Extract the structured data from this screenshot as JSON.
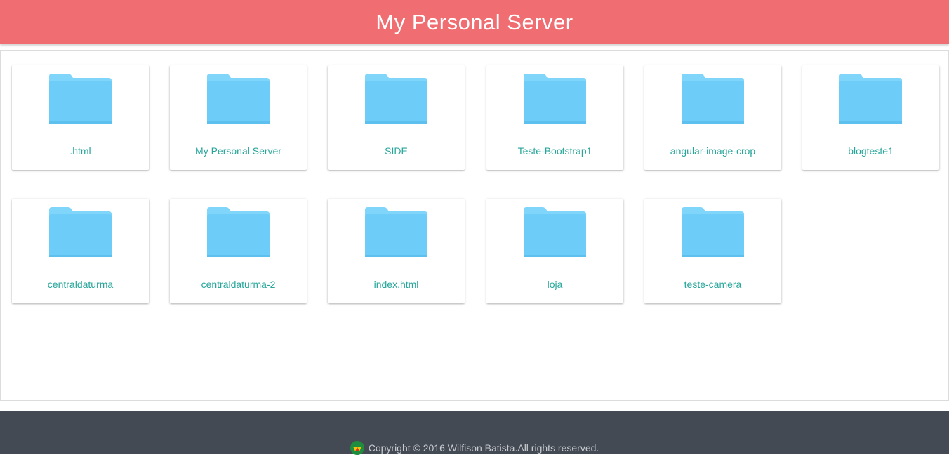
{
  "header": {
    "title": "My Personal Server"
  },
  "folders": [
    {
      "name": ".html",
      "icon": "folder-icon"
    },
    {
      "name": "My Personal Server",
      "icon": "folder-icon"
    },
    {
      "name": "SIDE",
      "icon": "folder-icon"
    },
    {
      "name": "Teste-Bootstrap1",
      "icon": "folder-icon"
    },
    {
      "name": "angular-image-crop",
      "icon": "folder-icon"
    },
    {
      "name": "blogteste1",
      "icon": "folder-icon"
    },
    {
      "name": "centraldaturma",
      "icon": "folder-icon"
    },
    {
      "name": "centraldaturma-2",
      "icon": "folder-icon"
    },
    {
      "name": "index.html",
      "icon": "folder-icon"
    },
    {
      "name": "loja",
      "icon": "folder-icon"
    },
    {
      "name": "teste-camera",
      "icon": "folder-icon"
    }
  ],
  "footer": {
    "copyright": "Copyright © 2016 Wilfison Batista.All rights reserved.",
    "logo_icon": "brand-logo-icon"
  },
  "colors": {
    "header_bg": "#f06d71",
    "folder_label": "#26a69a",
    "folder_icon": "#6dcdf8",
    "footer_bg": "#434a54"
  }
}
